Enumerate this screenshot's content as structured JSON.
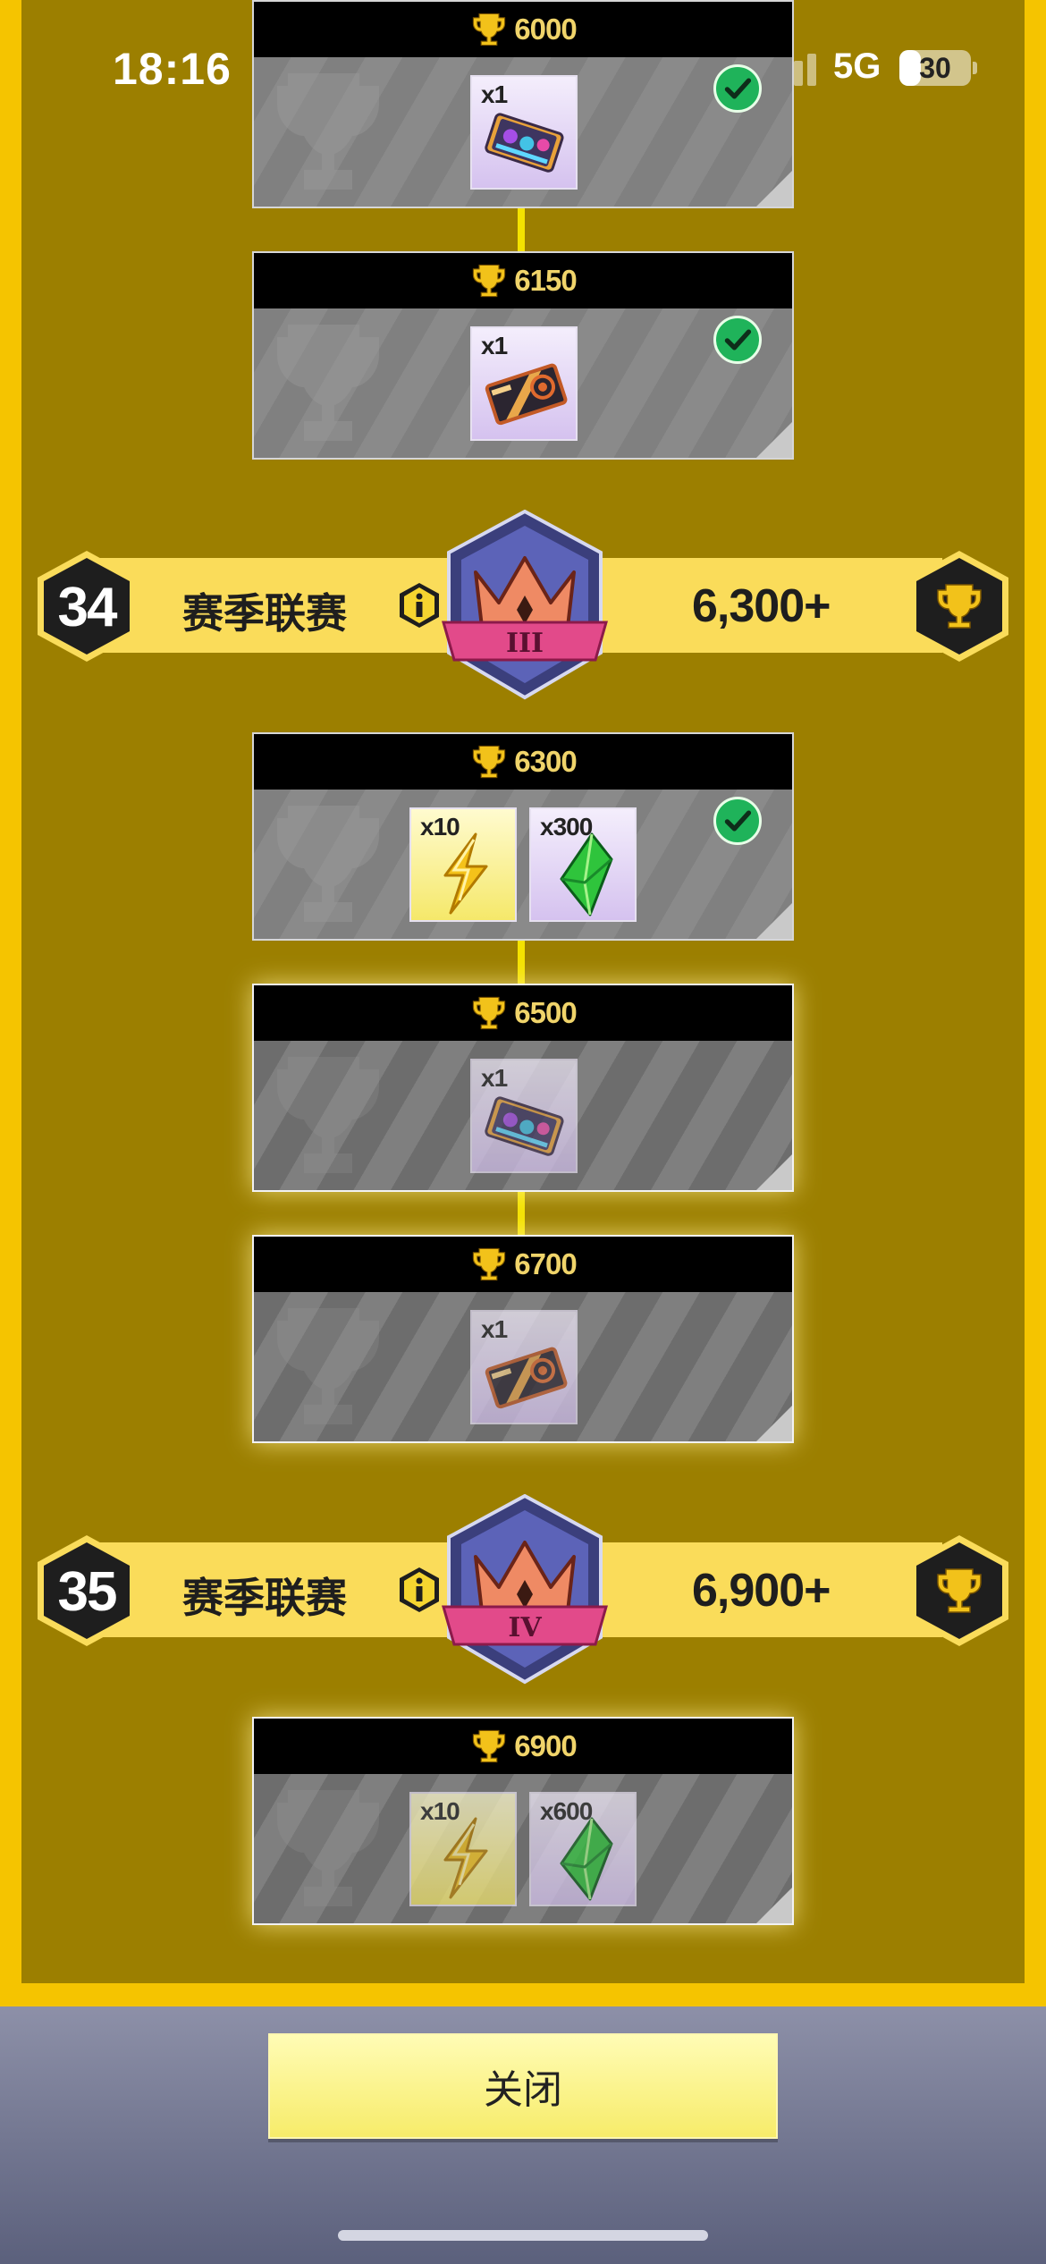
{
  "status_bar": {
    "time": "18:16",
    "network": "5G",
    "battery": "30",
    "battery_level": 0.3
  },
  "colors": {
    "background": "#9c7f00",
    "border": "#f5c400",
    "league_bar": "#fadc5a",
    "connector": "#f4e200",
    "claimed_check": "#1fb35a",
    "close_button": "#f7ec6a"
  },
  "tier1_rewards": [
    {
      "trophies": "6000",
      "claimed": true,
      "items": [
        {
          "qty": "x1",
          "icon": "card-pack-icon"
        }
      ]
    },
    {
      "trophies": "6150",
      "claimed": true,
      "items": [
        {
          "qty": "x1",
          "icon": "blueprint-ticket-icon"
        }
      ]
    }
  ],
  "league34": {
    "number": "34",
    "title": "赛季联赛",
    "rank_numeral": "III",
    "threshold": "6,300+"
  },
  "tier2_rewards": [
    {
      "trophies": "6300",
      "claimed": true,
      "items": [
        {
          "qty": "x10",
          "icon": "lightning-icon"
        },
        {
          "qty": "x300",
          "icon": "green-gem-icon"
        }
      ]
    },
    {
      "trophies": "6500",
      "claimed": false,
      "items": [
        {
          "qty": "x1",
          "icon": "card-pack-icon"
        }
      ]
    },
    {
      "trophies": "6700",
      "claimed": false,
      "items": [
        {
          "qty": "x1",
          "icon": "blueprint-ticket-icon"
        }
      ]
    }
  ],
  "league35": {
    "number": "35",
    "title": "赛季联赛",
    "rank_numeral": "IV",
    "threshold": "6,900+"
  },
  "tier3_rewards": [
    {
      "trophies": "6900",
      "claimed": false,
      "items": [
        {
          "qty": "x10",
          "icon": "lightning-icon"
        },
        {
          "qty": "x600",
          "icon": "green-gem-icon"
        }
      ]
    }
  ],
  "close_button": {
    "label": "关闭"
  }
}
